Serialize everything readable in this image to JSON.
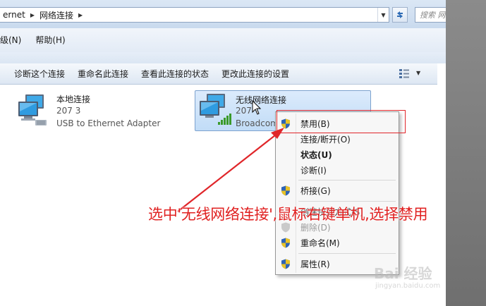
{
  "address_bar": {
    "segments": [
      "ernet",
      "网络连接"
    ],
    "search_placeholder": "搜索 网"
  },
  "menu": [
    "级(N)",
    "帮助(H)"
  ],
  "toolbar": [
    "诊断这个连接",
    "重命名此连接",
    "查看此连接的状态",
    "更改此连接的设置"
  ],
  "connections": [
    {
      "name": "本地连接",
      "line2": "207  3",
      "line3": "USB to Ethernet Adapter"
    },
    {
      "name": "无线网络连接",
      "line2": "207",
      "line3": "Broadcom"
    }
  ],
  "context_menu": {
    "items": [
      {
        "label": "禁用(B)",
        "shield": true,
        "bold": false,
        "disabled": false
      },
      {
        "label": "连接/断开(O)",
        "shield": false,
        "bold": false,
        "disabled": false
      },
      {
        "label": "状态(U)",
        "shield": false,
        "bold": true,
        "disabled": false
      },
      {
        "label": "诊断(I)",
        "shield": false,
        "bold": false,
        "disabled": false
      },
      {
        "label": "桥接(G)",
        "shield": true,
        "bold": false,
        "disabled": false
      },
      {
        "label": "创建快捷方式(S)",
        "shield": false,
        "bold": false,
        "disabled": false
      },
      {
        "label": "删除(D)",
        "shield": true,
        "bold": false,
        "disabled": true
      },
      {
        "label": "重命名(M)",
        "shield": true,
        "bold": false,
        "disabled": false
      },
      {
        "label": "属性(R)",
        "shield": true,
        "bold": false,
        "disabled": false
      }
    ]
  },
  "annotation": "选中'无线网络连接',鼠标右键单机,选择禁用",
  "watermark": {
    "main": "Bai 经验",
    "sub": "jingyan.baidu.com"
  },
  "colors": {
    "annotation": "#e02020",
    "highlight": "#e0262a",
    "selection": "#c1dcf7"
  }
}
